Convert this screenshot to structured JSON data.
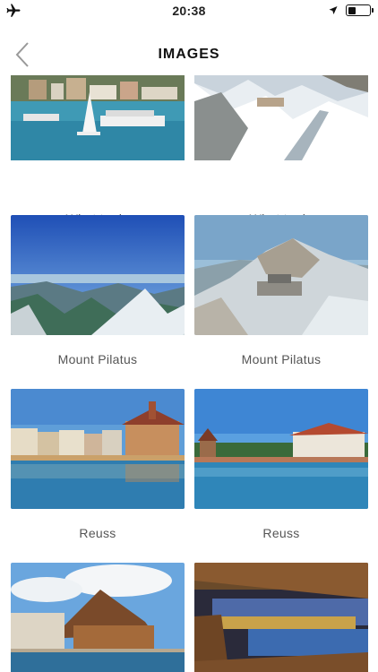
{
  "status": {
    "time": "20:38",
    "left_icon": "airplane-icon",
    "right_icons": [
      "location-arrow-icon",
      "battery-icon"
    ],
    "battery_level": 0.35
  },
  "nav": {
    "title": "IMAGES",
    "back_icon": "chevron-left-icon"
  },
  "cards": [
    {
      "label": "What to do"
    },
    {
      "label": "What to do"
    },
    {
      "label": "Mount Pilatus"
    },
    {
      "label": "Mount Pilatus"
    },
    {
      "label": "Reuss"
    },
    {
      "label": "Reuss"
    },
    {
      "label": ""
    },
    {
      "label": ""
    }
  ]
}
